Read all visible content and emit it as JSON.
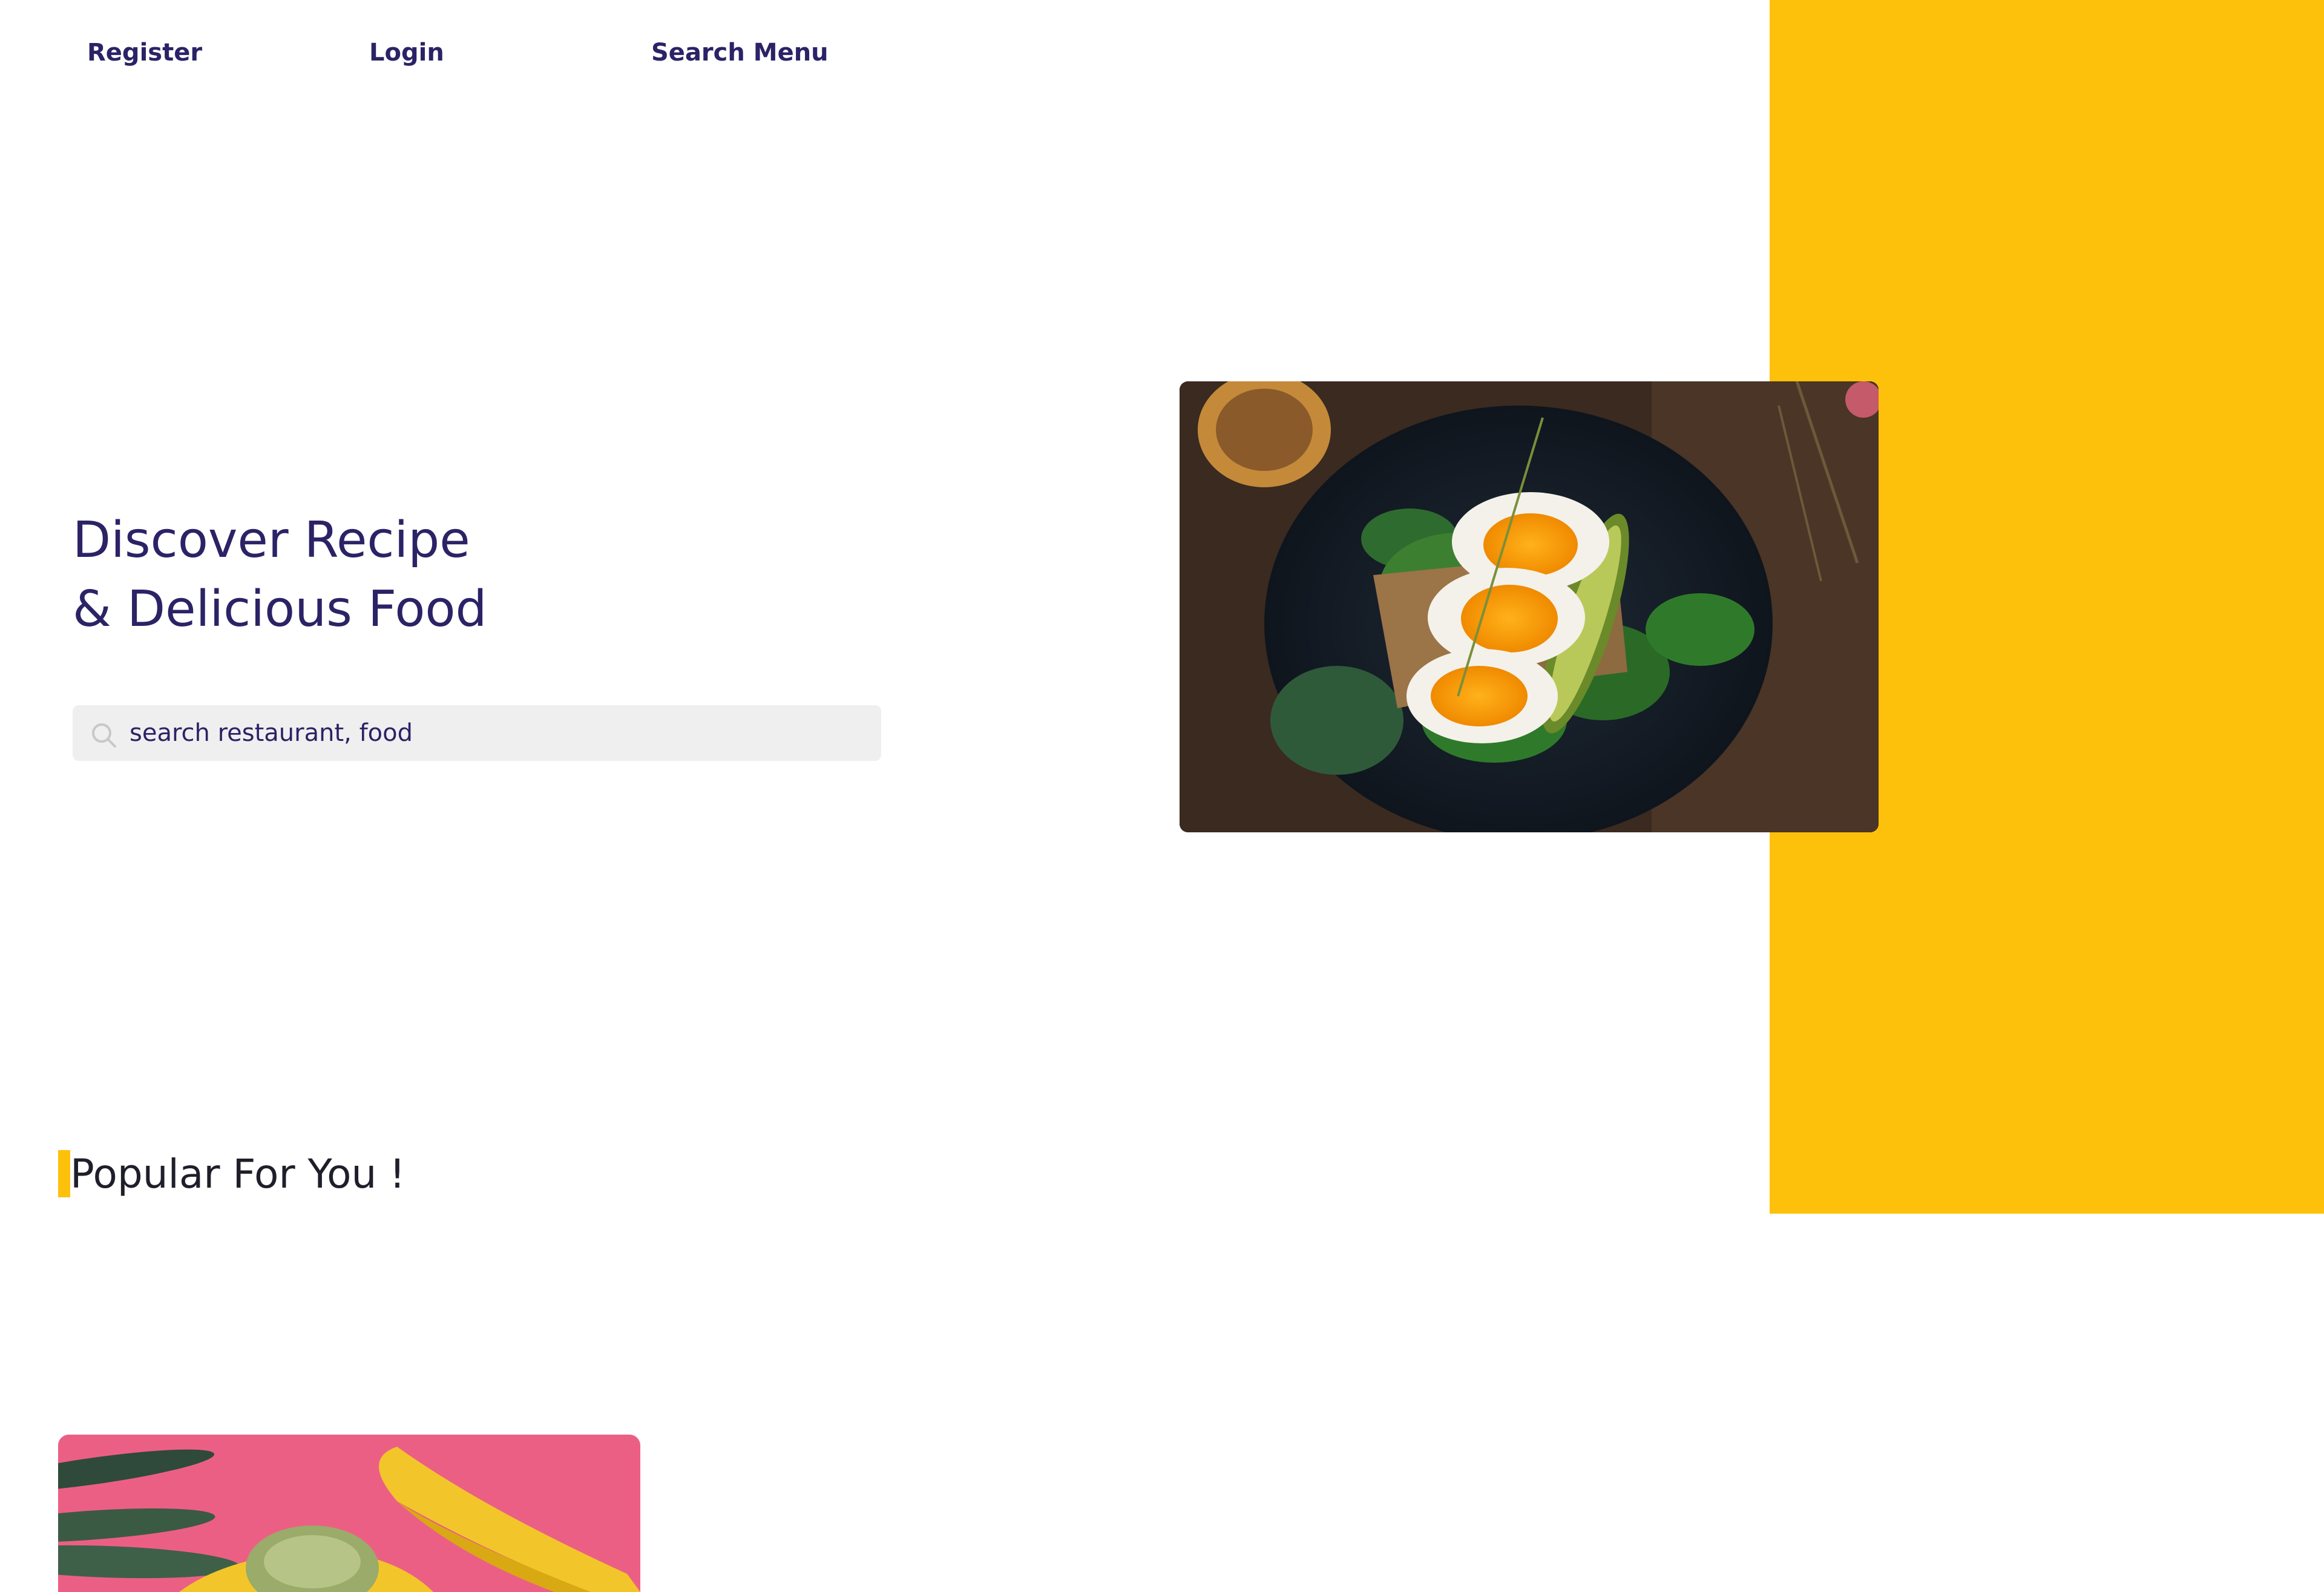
{
  "nav": {
    "register": "Register",
    "login": "Login",
    "search_menu": "Search Menu"
  },
  "hero": {
    "title_line1": "Discover Recipe",
    "title_line2": "& Delicious Food",
    "search_placeholder": "search restaurant, food",
    "image_description_icon": "food-photo-eggs-avocado-toast"
  },
  "popular": {
    "title": "Popular For You !",
    "card_image_icon": "food-photo-banana"
  },
  "colors": {
    "brand_dark": "#2b2366",
    "accent_yellow": "#fec10b",
    "search_bg": "#efefef",
    "card_pink": "#ec5f85"
  }
}
